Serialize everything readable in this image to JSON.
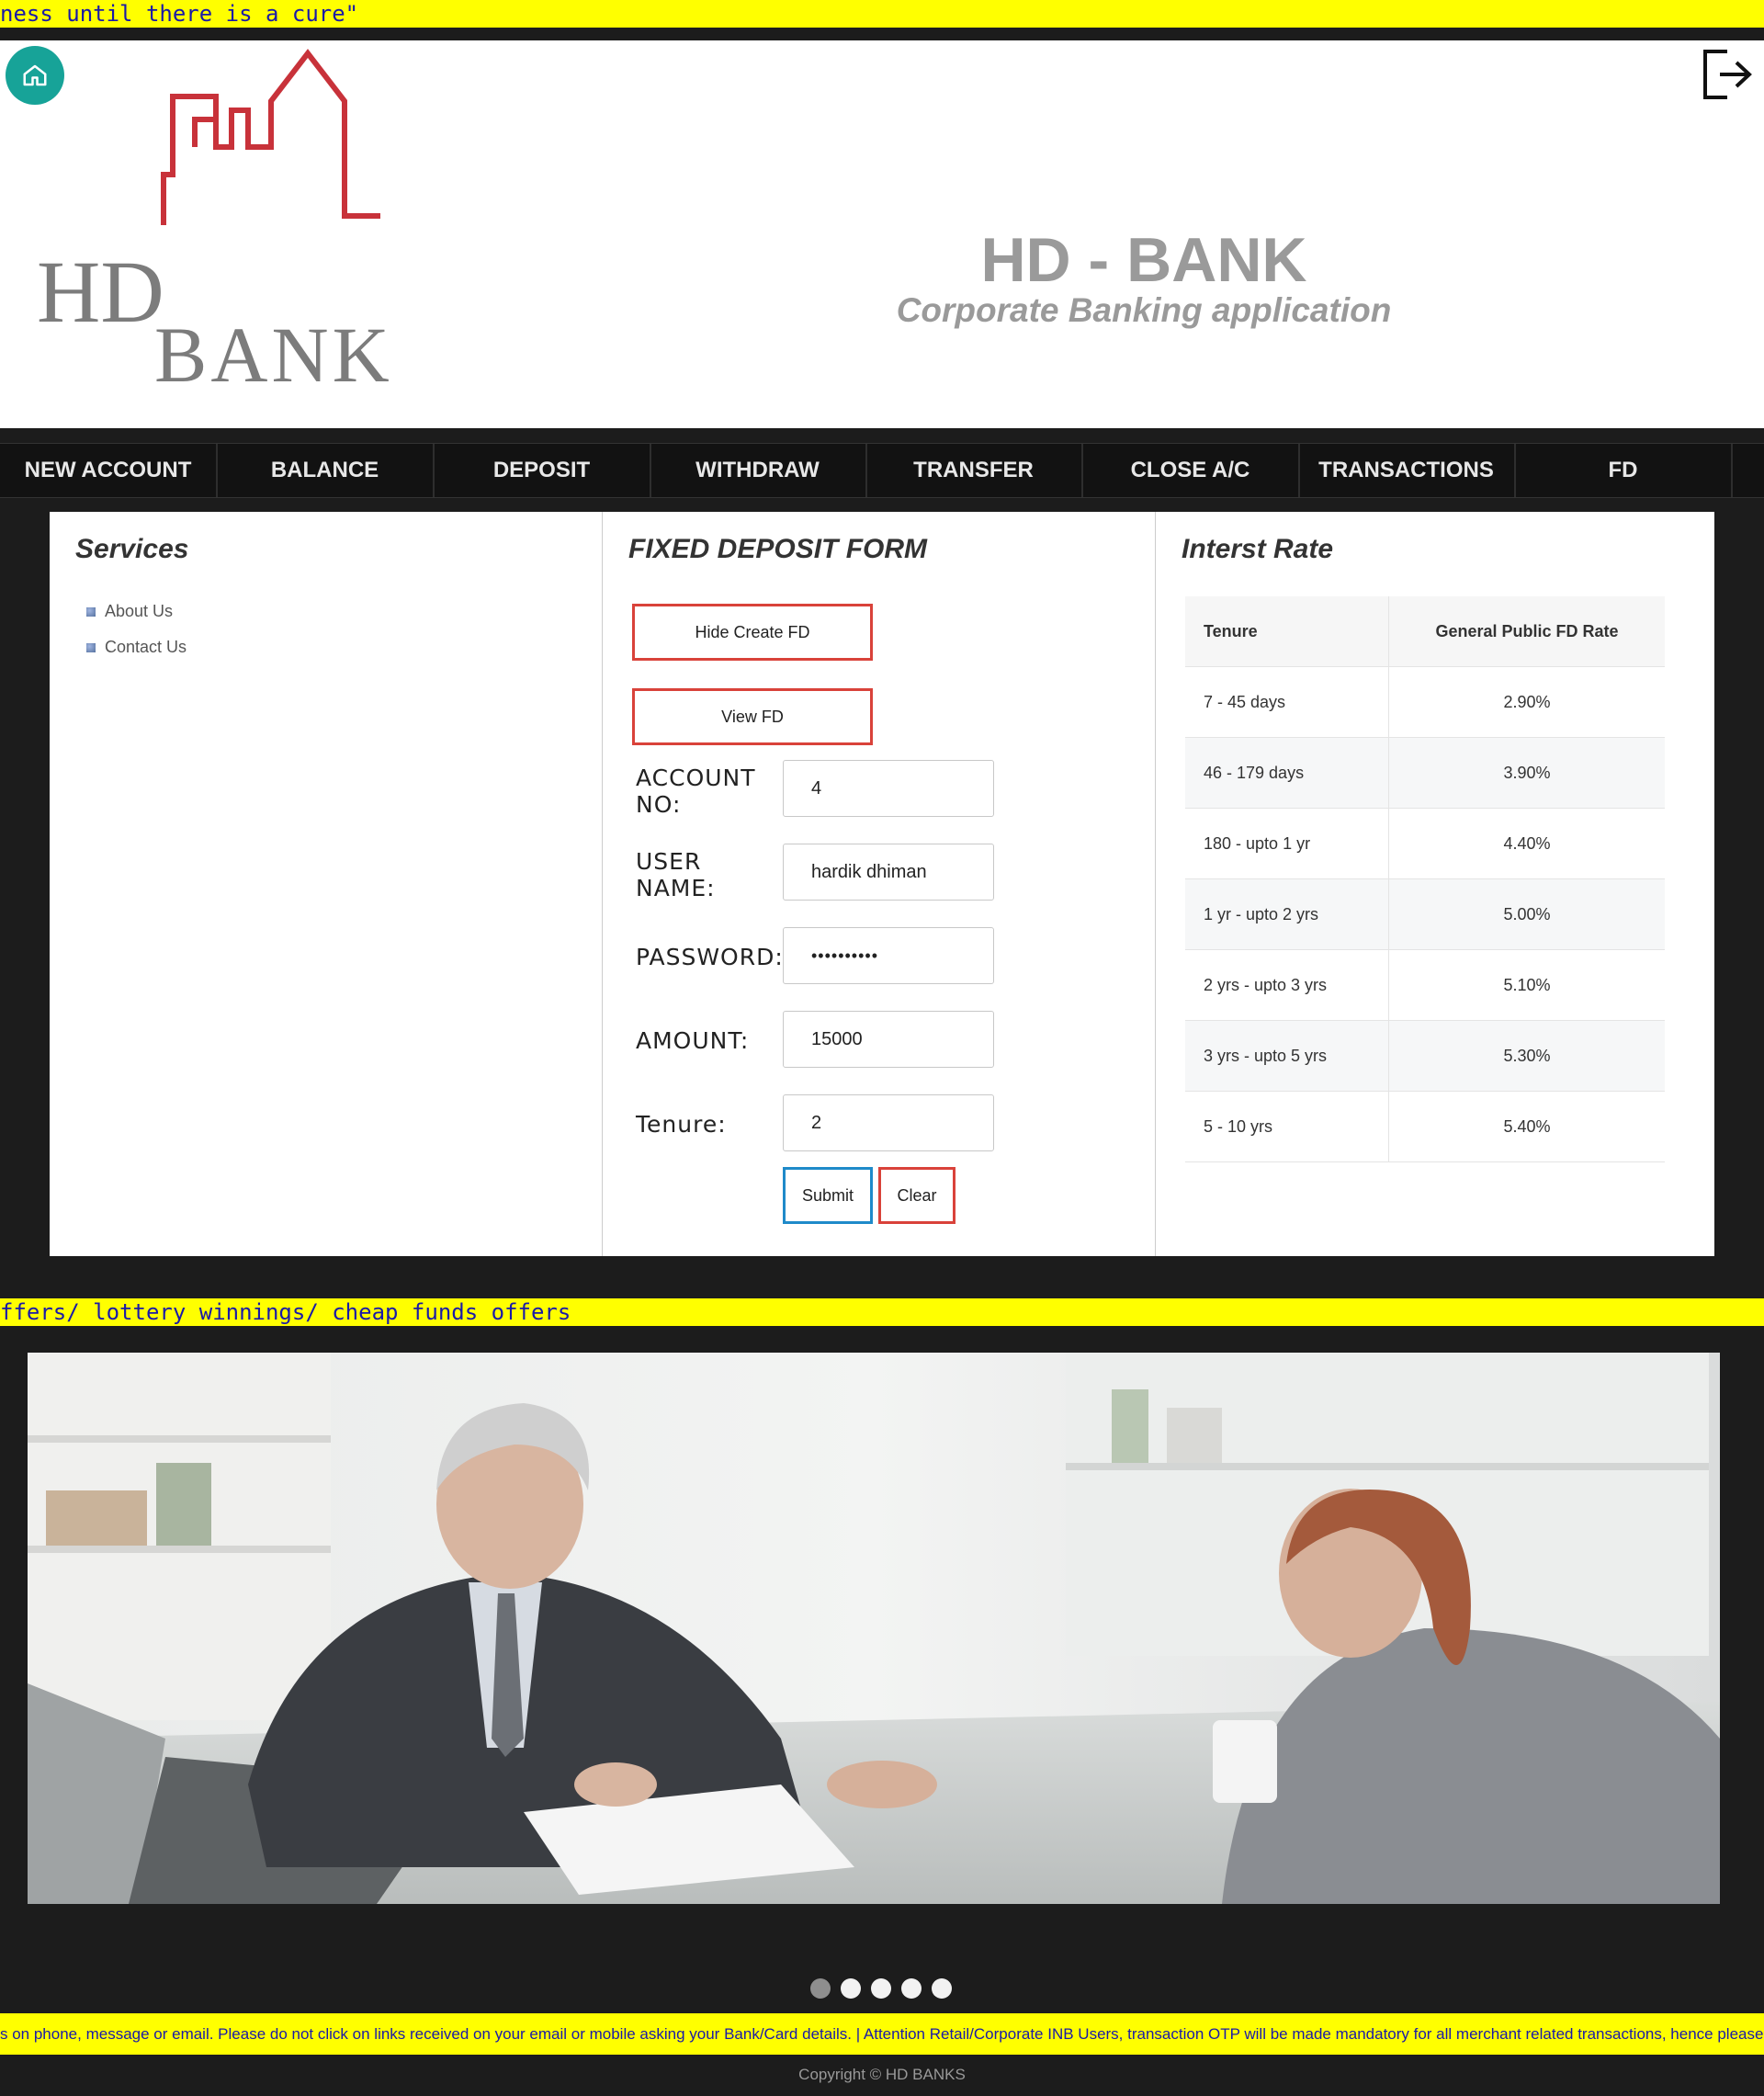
{
  "ticker_top": "ness until there is a cure\"",
  "header": {
    "logo_line1": "HD",
    "logo_line2": "BANK",
    "title": "HD - BANK",
    "subtitle": "Corporate Banking application"
  },
  "nav": [
    "NEW ACCOUNT",
    "BALANCE",
    "DEPOSIT",
    "WITHDRAW",
    "TRANSFER",
    "CLOSE A/C",
    "TRANSACTIONS",
    "FD"
  ],
  "services": {
    "title": "Services",
    "items": [
      "About Us",
      "Contact Us"
    ]
  },
  "fd_form": {
    "title": "FIXED DEPOSIT FORM",
    "hide_button": "Hide Create FD",
    "view_button": "View FD",
    "fields": {
      "account_label": "ACCOUNT NO:",
      "account_value": "4",
      "username_label": "USER NAME:",
      "username_value": "hardik dhiman",
      "password_label": "PASSWORD:",
      "password_value": "••••••••••",
      "amount_label": "AMOUNT:",
      "amount_value": "15000",
      "tenure_label": "Tenure:",
      "tenure_value": "2"
    },
    "submit": "Submit",
    "clear": "Clear"
  },
  "rates": {
    "title": "Interst Rate",
    "headers": [
      "Tenure",
      "General Public FD Rate"
    ],
    "rows": [
      [
        "7 - 45 days",
        "2.90%"
      ],
      [
        "46 - 179 days",
        "3.90%"
      ],
      [
        "180 - upto 1 yr",
        "4.40%"
      ],
      [
        "1 yr - upto 2 yrs",
        "5.00%"
      ],
      [
        "2 yrs - upto 3 yrs",
        "5.10%"
      ],
      [
        "3 yrs - upto 5 yrs",
        "5.30%"
      ],
      [
        "5 - 10 yrs",
        "5.40%"
      ]
    ]
  },
  "ticker_mid": "ffers/ lottery winnings/ cheap funds offers",
  "carousel": {
    "slide_count": 5,
    "active_index": 0
  },
  "ticker_bottom": "s on phone, message or email. Please do not click on links received on your email or mobile asking your Bank/Card details. | Attention Retail/Corporate INB Users, transaction OTP will be made mandatory for all merchant related transactions, hence please have yo",
  "footer": {
    "copyright": "Copyright © HD BANKS"
  },
  "colors": {
    "ticker_bg": "#ffff00",
    "ticker_text": "#1a1aa8",
    "home_button": "#17a398",
    "logo_red": "#c8323a",
    "outline_red": "#d9423a",
    "submit_blue": "#1f8ac9"
  }
}
